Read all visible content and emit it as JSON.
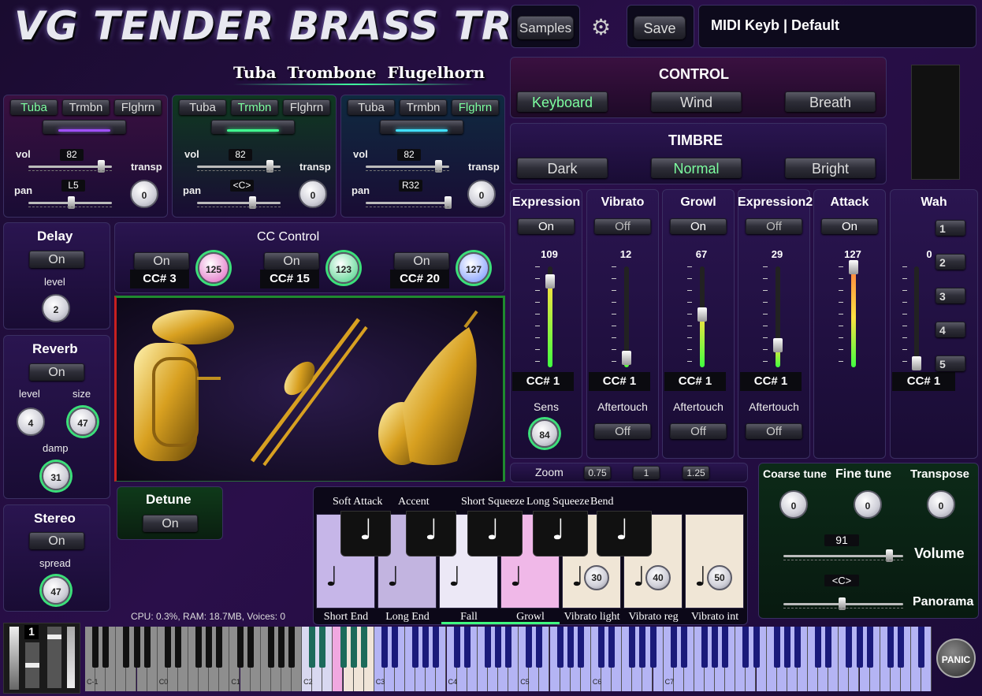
{
  "app": {
    "title": "VG TENDER BRASS TRIO",
    "subtitle": "Tuba  Trombone  Flugelhorn"
  },
  "top": {
    "samples": "Samples",
    "save": "Save",
    "preset": "MIDI Keyb | Default"
  },
  "inst_tabs": [
    "Tuba",
    "Trmbn",
    "Flghrn"
  ],
  "channels": [
    {
      "vol": "82",
      "pan": "L5",
      "transp": "0",
      "active": 0,
      "color": "#a050ff"
    },
    {
      "vol": "82",
      "pan": "<C>",
      "transp": "0",
      "active": 1,
      "color": "#40ff90"
    },
    {
      "vol": "82",
      "pan": "R32",
      "transp": "0",
      "active": 2,
      "color": "#40e0ff"
    }
  ],
  "labels": {
    "vol": "vol",
    "pan": "pan",
    "transp": "transp",
    "level": "level",
    "size": "size",
    "damp": "damp",
    "spread": "spread",
    "on": "On",
    "off": "Off",
    "sens": "Sens",
    "aftertouch": "Aftertouch",
    "zoom": "Zoom"
  },
  "control": {
    "title": "CONTROL",
    "options": [
      "Keyboard",
      "Wind",
      "Breath"
    ],
    "selected": 0
  },
  "timbre": {
    "title": "TIMBRE",
    "options": [
      "Dark",
      "Normal",
      "Bright"
    ],
    "selected": 1
  },
  "delay": {
    "title": "Delay",
    "state": "On",
    "level": "2"
  },
  "reverb": {
    "title": "Reverb",
    "state": "On",
    "level": "4",
    "size": "47",
    "damp": "31"
  },
  "stereo": {
    "title": "Stereo",
    "state": "On",
    "spread": "47"
  },
  "detune": {
    "title": "Detune",
    "state": "On"
  },
  "cc_control": {
    "title": "CC Control",
    "items": [
      {
        "state": "On",
        "cc": "CC# 3",
        "value": "125",
        "color": "#e060c0"
      },
      {
        "state": "On",
        "cc": "CC# 15",
        "value": "123",
        "color": "#40d080"
      },
      {
        "state": "On",
        "cc": "CC# 20",
        "value": "127",
        "color": "#7090ff"
      }
    ]
  },
  "strips": [
    {
      "title": "Expression",
      "state": "On",
      "value": "109",
      "cc": "CC# 1",
      "extra": "Sens",
      "knob": "84",
      "level": 0.86
    },
    {
      "title": "Vibrato",
      "state": "Off",
      "value": "12",
      "cc": "CC# 1",
      "extra": "Aftertouch",
      "btn": "Off",
      "level": 0.1
    },
    {
      "title": "Growl",
      "state": "On",
      "value": "67",
      "cc": "CC# 1",
      "extra": "Aftertouch",
      "btn": "Off",
      "level": 0.53
    },
    {
      "title": "Expression2",
      "state": "Off",
      "value": "29",
      "cc": "CC# 1",
      "extra": "Aftertouch",
      "btn": "Off",
      "level": 0.23
    },
    {
      "title": "Attack",
      "state": "On",
      "value": "127",
      "level": 1.0
    },
    {
      "title": "Wah",
      "value": "0",
      "cc": "CC# 1",
      "level": 0.05,
      "buttons": [
        "1",
        "2",
        "3",
        "4",
        "5"
      ]
    }
  ],
  "zoom": {
    "options": [
      "0.75",
      "1",
      "1.25"
    ]
  },
  "articulations": {
    "top": [
      "Soft Attack",
      "Accent",
      "Short Squeeze",
      "Long Squeeze",
      "Bend"
    ],
    "bottom": [
      "Short End",
      "Long End",
      "Fall",
      "Growl",
      "Vibrato light",
      "Vibrato reg",
      "Vibrato int"
    ],
    "vib_values": [
      "30",
      "40",
      "50"
    ]
  },
  "tune": {
    "coarse": "Coarse tune",
    "fine": "Fine tune",
    "transpose": "Transpose",
    "coarse_val": "0",
    "fine_val": "0",
    "transpose_val": "0",
    "volume_label": "Volume",
    "volume": "91",
    "panorama_label": "Panorama",
    "panorama": "<C>"
  },
  "status": "CPU: 0.3%, RAM: 18.7MB, Voices: 0",
  "keyboard": {
    "octaves": [
      "C-1",
      "C0",
      "C1",
      "C2",
      "C3",
      "C4",
      "C5",
      "C6",
      "C7"
    ],
    "panic": "PANIC",
    "channel": "1"
  }
}
